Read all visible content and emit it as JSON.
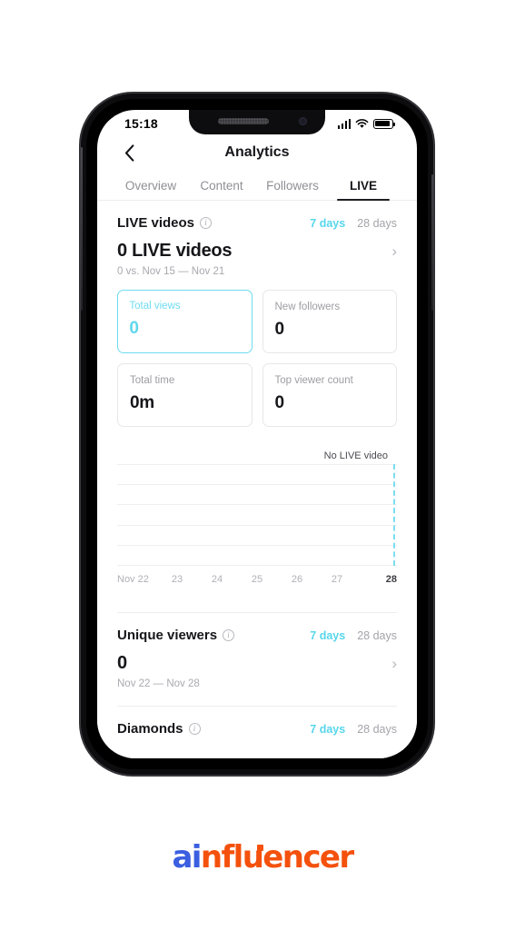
{
  "status_bar": {
    "time": "15:18",
    "signal_icon": "signal-bars-icon",
    "wifi_icon": "wifi-icon",
    "battery_icon": "battery-icon"
  },
  "nav": {
    "back_icon": "chevron-left-icon",
    "title": "Analytics"
  },
  "tabs": [
    {
      "label": "Overview",
      "active": false
    },
    {
      "label": "Content",
      "active": false
    },
    {
      "label": "Followers",
      "active": false
    },
    {
      "label": "LIVE",
      "active": true
    }
  ],
  "live_videos": {
    "title": "LIVE videos",
    "info_icon": "info-icon",
    "range_7": "7 days",
    "range_28": "28 days",
    "selected_range": "7 days",
    "headline": "0 LIVE videos",
    "chevron": "›",
    "comparison": "0 vs. Nov 15 — Nov 21",
    "metrics": [
      {
        "label": "Total views",
        "value": "0",
        "selected": true
      },
      {
        "label": "New followers",
        "value": "0",
        "selected": false
      },
      {
        "label": "Total time",
        "value": "0m",
        "selected": false
      },
      {
        "label": "Top viewer count",
        "value": "0",
        "selected": false
      }
    ]
  },
  "chart_data": {
    "type": "line",
    "title": "",
    "annotation": "No LIVE video",
    "categories": [
      "Nov 22",
      "23",
      "24",
      "25",
      "26",
      "27",
      "28"
    ],
    "values": [
      0,
      0,
      0,
      0,
      0,
      0,
      0
    ],
    "ylabel": "",
    "xlabel": "",
    "ylim": [
      0,
      0
    ],
    "grid": true,
    "gridline_count": 6,
    "marker": {
      "category": "28",
      "style": "dashed-vertical",
      "color": "#7ddcf0"
    },
    "highlighted_tick": "28",
    "legend": "none"
  },
  "unique_viewers": {
    "title": "Unique viewers",
    "info_icon": "info-icon",
    "range_7": "7 days",
    "range_28": "28 days",
    "selected_range": "7 days",
    "value": "0",
    "chevron": "›",
    "date_range": "Nov 22 — Nov 28"
  },
  "diamonds": {
    "title": "Diamonds",
    "info_icon": "info-icon",
    "range_7": "7 days",
    "range_28": "28 days",
    "selected_range": "7 days"
  },
  "brand": {
    "part1": "a",
    "part2": "i",
    "part3": "nfluencer",
    "color_blue": "#3b5fe0",
    "color_orange": "#f4510d"
  },
  "accent": {
    "cyan": "#57d6ec",
    "dark": "#16161a"
  }
}
